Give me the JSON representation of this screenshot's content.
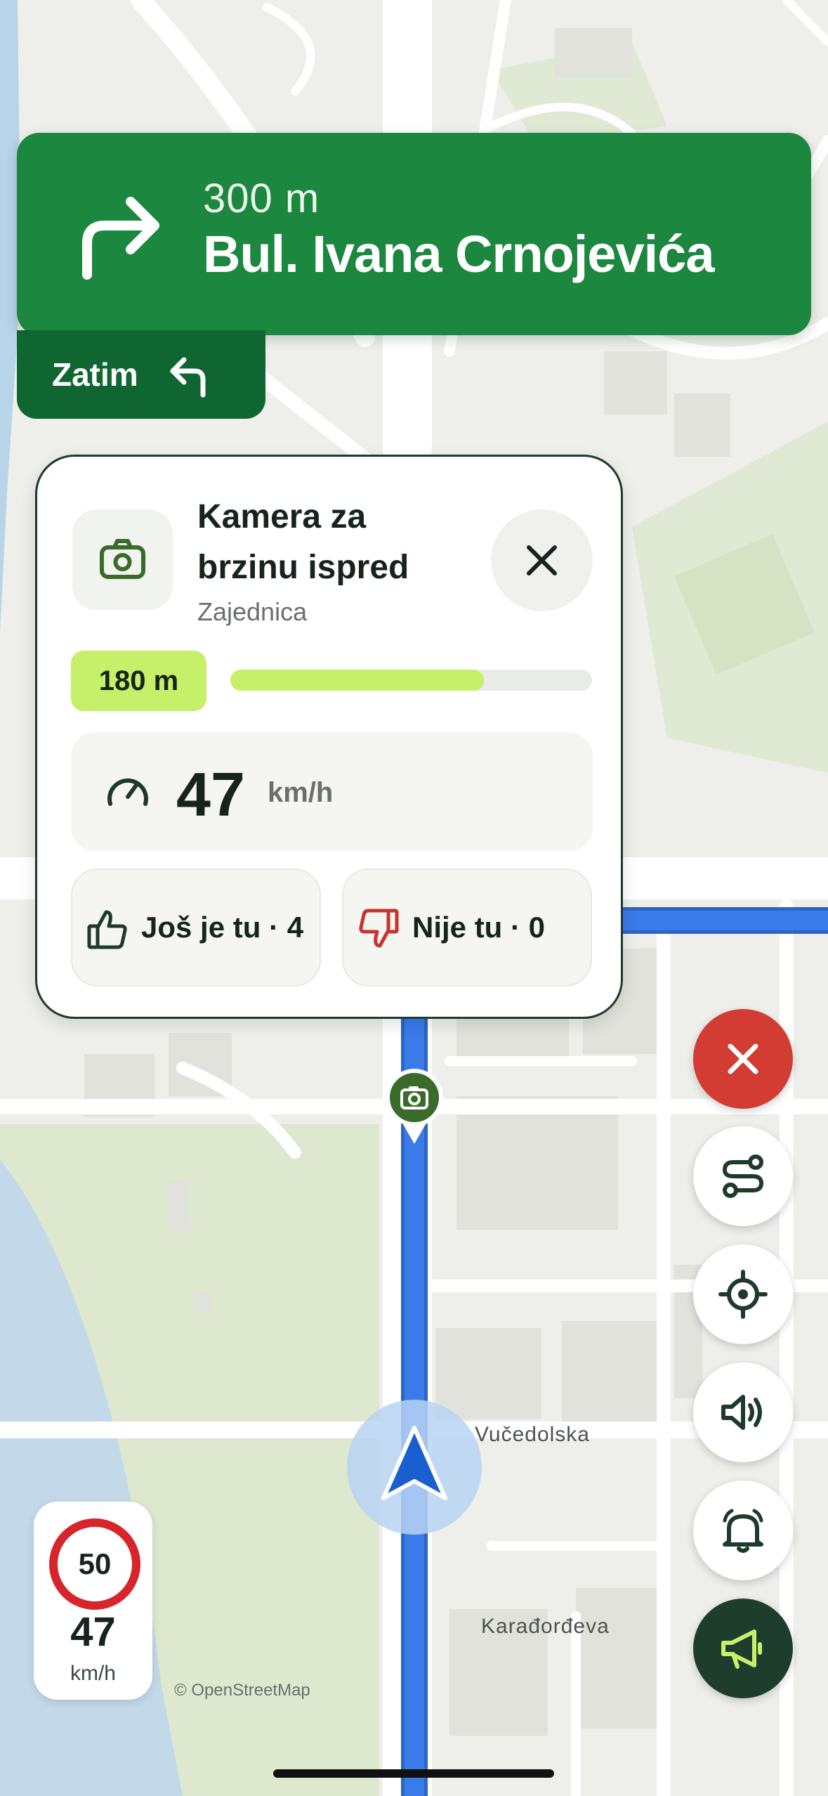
{
  "navigation": {
    "distance": "300 m",
    "street": "Bul. Ivana Crnojevića",
    "then_label": "Zatim"
  },
  "camera_card": {
    "title": "Kamera za brzinu ispred",
    "subtitle": "Zajednica",
    "distance": "180 m",
    "progress": 0.7,
    "speed_value": "47",
    "speed_unit": "km/h",
    "still_there_label": "Još je tu · 4",
    "not_there_label": "Nije tu · 0"
  },
  "speed_panel": {
    "limit": "50",
    "current_speed": "47",
    "unit": "km/h"
  },
  "map": {
    "street_1": "Vučedolska",
    "street_2": "Karađorđeva",
    "attribution": "© OpenStreetMap"
  },
  "colors": {
    "nav_green": "#1b873f",
    "then_green": "#0f6630",
    "accent_lime": "#c6ef6a",
    "route_blue": "#3a7bea",
    "close_red": "#d23c32",
    "report_dark": "#1f3d2c"
  },
  "icons": [
    "turn-right-icon",
    "turn-left-icon",
    "camera-icon",
    "close-icon",
    "speedometer-icon",
    "thumbs-up-icon",
    "thumbs-down-icon",
    "route-icon",
    "locate-icon",
    "volume-icon",
    "bell-icon",
    "megaphone-icon",
    "navigation-arrow-icon"
  ]
}
